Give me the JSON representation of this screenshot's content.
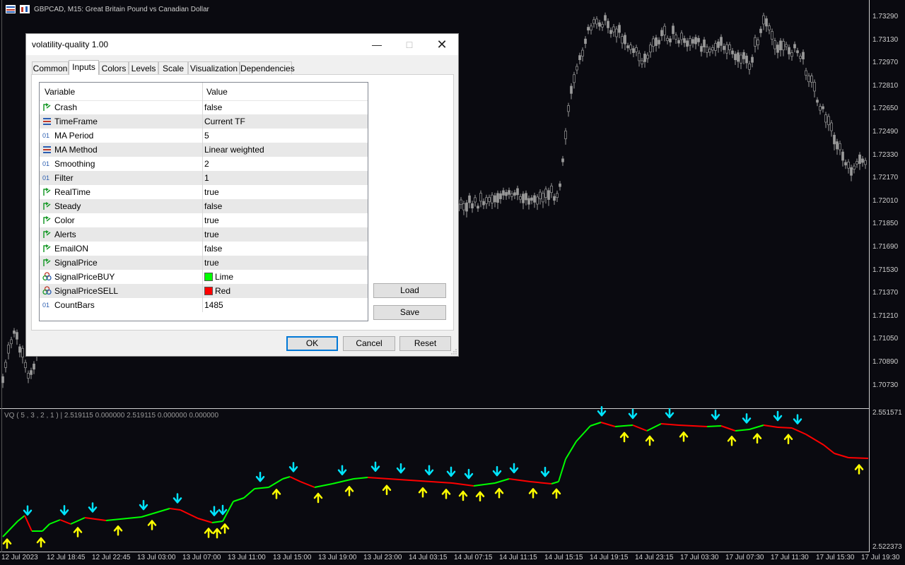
{
  "chart": {
    "title": "GBPCAD, M15:  Great Britain Pound vs Canadian Dollar",
    "price_scale": [
      "1.73290",
      "1.73130",
      "1.72970",
      "1.72810",
      "1.72650",
      "1.72490",
      "1.72330",
      "1.72170",
      "1.72010",
      "1.71850",
      "1.71690",
      "1.71530",
      "1.71370",
      "1.71210",
      "1.71050",
      "1.70890",
      "1.70730"
    ],
    "time_axis": [
      "12 Jul 2023",
      "12 Jul 18:45",
      "12 Jul 22:45",
      "13 Jul 03:00",
      "13 Jul 07:00",
      "13 Jul 11:00",
      "13 Jul 15:00",
      "13 Jul 19:00",
      "13 Jul 23:00",
      "14 Jul 03:15",
      "14 Jul 07:15",
      "14 Jul 11:15",
      "14 Jul 15:15",
      "14 Jul 19:15",
      "14 Jul 23:15",
      "17 Jul 03:30",
      "17 Jul 07:30",
      "17 Jul 11:30",
      "17 Jul 15:30",
      "17 Jul 19:30"
    ],
    "indicator_label": "VQ ( 5 , 3 , 2 , 1 )  |  2.519115 0.000000 2.519115 0.000000 0.000000",
    "indicator_scale_top": "2.551571",
    "indicator_scale_bottom": "2.522373",
    "colors": {
      "up": "#00ff00",
      "down": "#ff0000",
      "buy_arrow": "#ffff00",
      "sell_arrow": "#00e5ff",
      "candle": "#9a9a9a",
      "background": "#0a0a10"
    }
  },
  "dialog": {
    "title": "volatility-quality 1.00",
    "tabs": [
      "Common",
      "Inputs",
      "Colors",
      "Levels",
      "Scale",
      "Visualization",
      "Dependencies"
    ],
    "active_tab": "Inputs",
    "columns": {
      "variable": "Variable",
      "value": "Value"
    },
    "rows": [
      {
        "icon": "bool-icon",
        "name": "Crash",
        "value": "false"
      },
      {
        "icon": "enum-icon",
        "name": "TimeFrame",
        "value": "Current TF"
      },
      {
        "icon": "int-icon",
        "name": "MA Period",
        "value": "5"
      },
      {
        "icon": "enum-icon",
        "name": "MA Method",
        "value": "Linear weighted"
      },
      {
        "icon": "int-icon",
        "name": "Smoothing",
        "value": "2"
      },
      {
        "icon": "int-icon",
        "name": "Filter",
        "value": "1"
      },
      {
        "icon": "bool-icon",
        "name": "RealTime",
        "value": "true"
      },
      {
        "icon": "bool-icon",
        "name": "Steady",
        "value": "false"
      },
      {
        "icon": "bool-icon",
        "name": "Color",
        "value": "true"
      },
      {
        "icon": "bool-icon",
        "name": "Alerts",
        "value": "true"
      },
      {
        "icon": "bool-icon",
        "name": "EmailON",
        "value": "false"
      },
      {
        "icon": "bool-icon",
        "name": "SignalPrice",
        "value": "true"
      },
      {
        "icon": "color-icon",
        "name": "SignalPriceBUY",
        "value": "Lime",
        "swatch": "#00ff00"
      },
      {
        "icon": "color-icon",
        "name": "SignalPriceSELL",
        "value": "Red",
        "swatch": "#ff0000"
      },
      {
        "icon": "int-icon",
        "name": "CountBars",
        "value": "1485"
      }
    ],
    "buttons": {
      "load": "Load",
      "save": "Save",
      "ok": "OK",
      "cancel": "Cancel",
      "reset": "Reset"
    }
  }
}
